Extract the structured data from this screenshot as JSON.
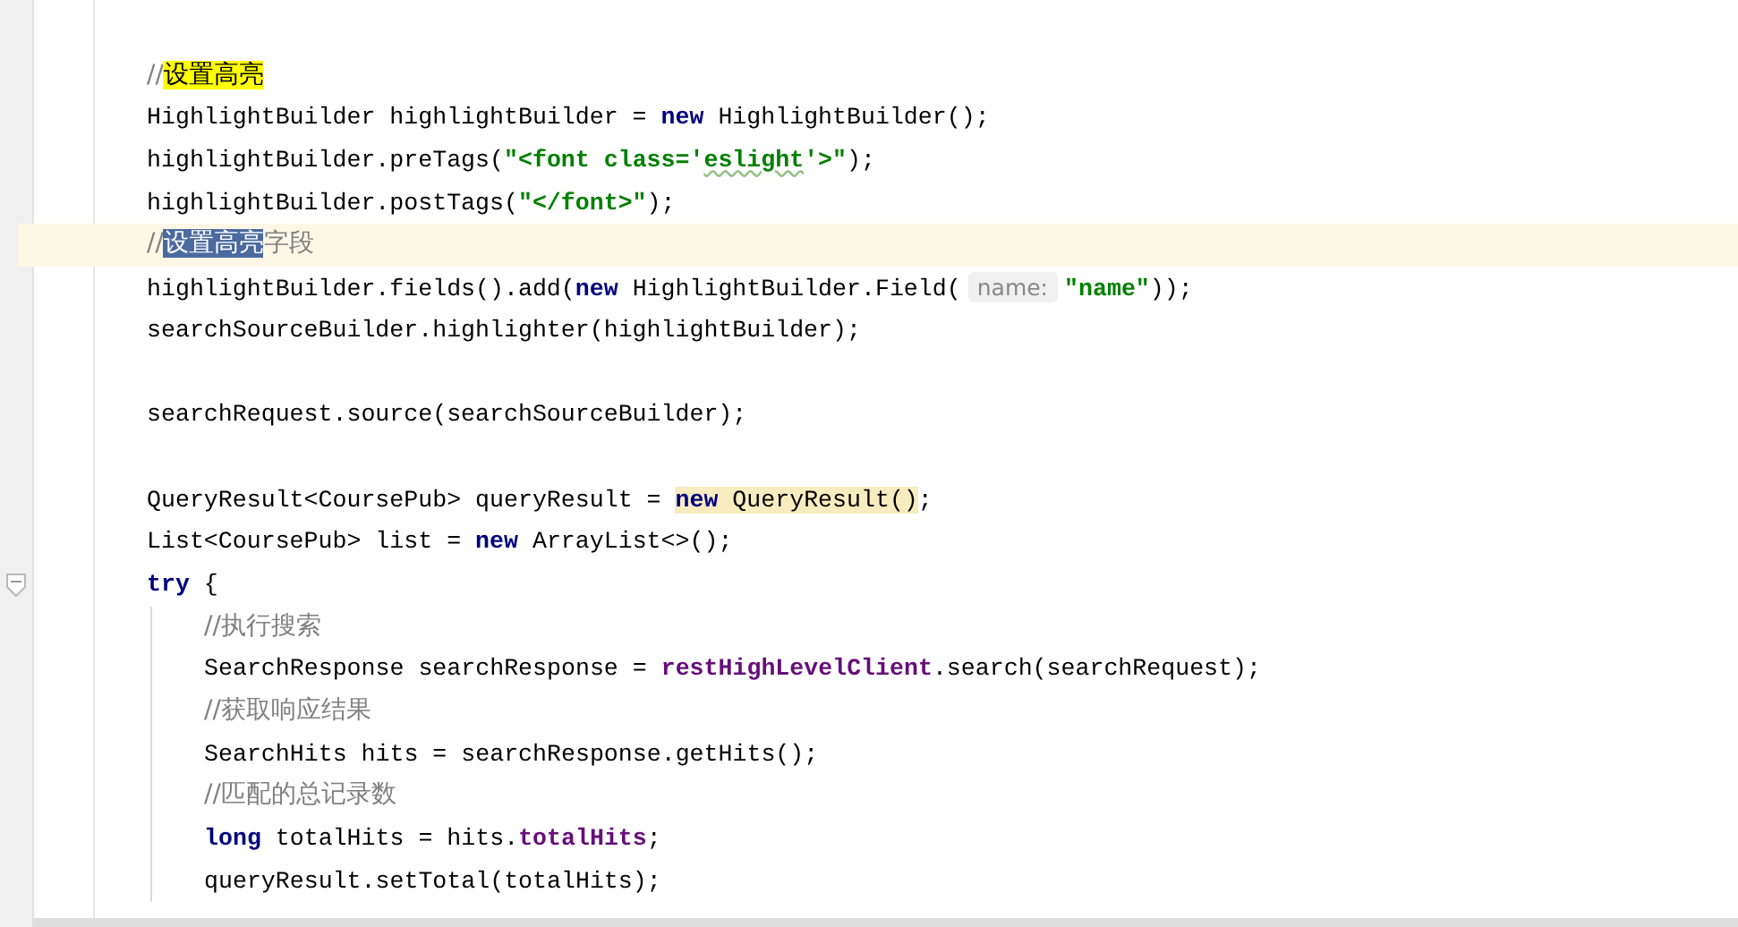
{
  "editor": {
    "lines": [
      {
        "kind": "blank",
        "current": false
      },
      {
        "kind": "code",
        "current": false,
        "tokens": [
          {
            "kind": "comment",
            "text": "//"
          },
          {
            "kind": "match",
            "text": "设置高亮"
          }
        ]
      },
      {
        "kind": "code",
        "current": false,
        "tokens": [
          {
            "kind": "text",
            "text": "HighlightBuilder highlightBuilder = "
          },
          {
            "kind": "keyword",
            "text": "new"
          },
          {
            "kind": "text",
            "text": " HighlightBuilder();"
          }
        ]
      },
      {
        "kind": "code",
        "current": false,
        "tokens": [
          {
            "kind": "text",
            "text": "highlightBuilder.preTags("
          },
          {
            "kind": "string",
            "text": "\"<font class='"
          },
          {
            "kind": "string_typo",
            "text": "eslight"
          },
          {
            "kind": "string",
            "text": "'>\""
          },
          {
            "kind": "text",
            "text": ");"
          }
        ]
      },
      {
        "kind": "code",
        "current": false,
        "tokens": [
          {
            "kind": "text",
            "text": "highlightBuilder.postTags("
          },
          {
            "kind": "string",
            "text": "\"</font>\""
          },
          {
            "kind": "text",
            "text": ");"
          }
        ]
      },
      {
        "kind": "code",
        "current": true,
        "tokens": [
          {
            "kind": "comment",
            "text": "//"
          },
          {
            "kind": "selection",
            "text": "设置高亮"
          },
          {
            "kind": "comment",
            "text": "字段"
          }
        ]
      },
      {
        "kind": "code",
        "current": false,
        "tokens": [
          {
            "kind": "text",
            "text": "highlightBuilder.fields().add("
          },
          {
            "kind": "keyword",
            "text": "new"
          },
          {
            "kind": "text",
            "text": " HighlightBuilder.Field("
          },
          {
            "kind": "hint",
            "text": "name:"
          },
          {
            "kind": "string",
            "text": "\"name\""
          },
          {
            "kind": "text",
            "text": "));"
          }
        ]
      },
      {
        "kind": "code",
        "current": false,
        "tokens": [
          {
            "kind": "text",
            "text": "searchSourceBuilder.highlighter(highlightBuilder);"
          }
        ]
      },
      {
        "kind": "blank",
        "current": false
      },
      {
        "kind": "code",
        "current": false,
        "tokens": [
          {
            "kind": "text",
            "text": "searchRequest.source(searchSourceBuilder);"
          }
        ]
      },
      {
        "kind": "blank",
        "current": false
      },
      {
        "kind": "code",
        "current": false,
        "tokens": [
          {
            "kind": "text",
            "text": "QueryResult<CoursePub> queryResult = "
          },
          {
            "kind": "keyword_usage",
            "text": "new"
          },
          {
            "kind": "text_usage",
            "text": " QueryResult()"
          },
          {
            "kind": "text",
            "text": ";"
          }
        ]
      },
      {
        "kind": "code",
        "current": false,
        "tokens": [
          {
            "kind": "text",
            "text": "List<CoursePub> list = "
          },
          {
            "kind": "keyword",
            "text": "new"
          },
          {
            "kind": "text",
            "text": " ArrayList<>();"
          }
        ]
      },
      {
        "kind": "code",
        "current": false,
        "tokens": [
          {
            "kind": "keyword",
            "text": "try"
          },
          {
            "kind": "text",
            "text": " {"
          }
        ],
        "children": [
          {
            "kind": "code",
            "current": false,
            "tokens": [
              {
                "kind": "comment",
                "text": "//执行搜索"
              }
            ]
          },
          {
            "kind": "code",
            "current": false,
            "tokens": [
              {
                "kind": "text",
                "text": "SearchResponse searchResponse = "
              },
              {
                "kind": "field",
                "text": "restHighLevelClient"
              },
              {
                "kind": "text",
                "text": ".search(searchRequest);"
              }
            ]
          },
          {
            "kind": "code",
            "current": false,
            "tokens": [
              {
                "kind": "comment",
                "text": "//获取响应结果"
              }
            ]
          },
          {
            "kind": "code",
            "current": false,
            "tokens": [
              {
                "kind": "text",
                "text": "SearchHits hits = searchResponse.getHits();"
              }
            ]
          },
          {
            "kind": "code",
            "current": false,
            "tokens": [
              {
                "kind": "comment",
                "text": "//匹配的总记录数"
              }
            ]
          },
          {
            "kind": "code",
            "current": false,
            "tokens": [
              {
                "kind": "keyword",
                "text": "long"
              },
              {
                "kind": "text",
                "text": " totalHits = hits."
              },
              {
                "kind": "field",
                "text": "totalHits"
              },
              {
                "kind": "text",
                "text": ";"
              }
            ]
          },
          {
            "kind": "code",
            "current": false,
            "tokens": [
              {
                "kind": "text",
                "text": "queryResult.setTotal(totalHits);"
              }
            ]
          }
        ]
      }
    ]
  }
}
